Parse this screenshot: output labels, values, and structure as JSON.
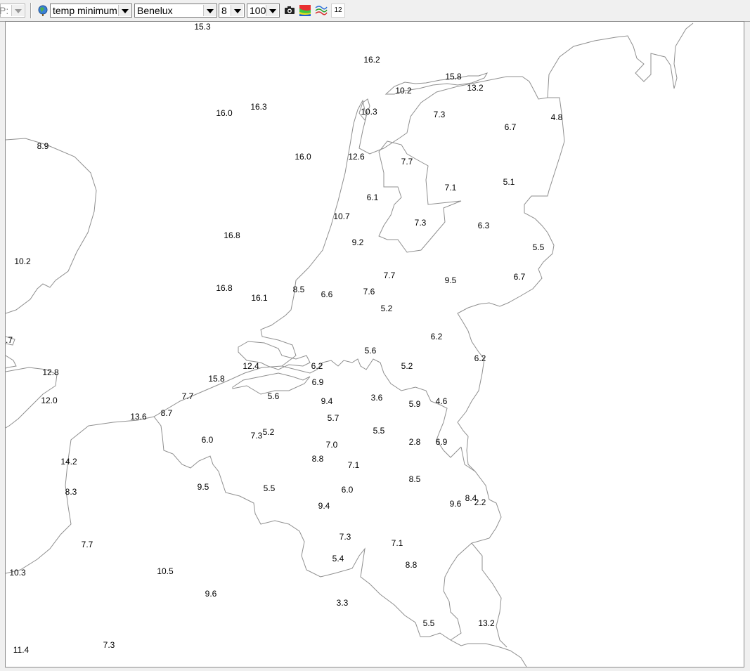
{
  "toolbar": {
    "partial_combo_text": "P:",
    "parameter_select": "temp minimum",
    "region_select": "Benelux",
    "level_select": "8",
    "zoom_select": "100",
    "badge": "12",
    "icons": [
      "globe-icon",
      "camera-icon",
      "color-map-icon",
      "streamlines-icon"
    ]
  },
  "map": {
    "region": "Benelux",
    "parameter": "temp minimum",
    "labels": [
      {
        "v": "15.3",
        "lon": 0,
        "lat": 0
      },
      {
        "v": "16.2"
      },
      {
        "v": "15.8"
      },
      {
        "v": "10.2"
      },
      {
        "v": "13.2"
      },
      {
        "v": "16.0"
      },
      {
        "v": "16.3"
      },
      {
        "v": "10.3"
      },
      {
        "v": "7.3"
      },
      {
        "v": "6.7"
      },
      {
        "v": "4.8"
      },
      {
        "v": "8.9"
      },
      {
        "v": "16.0"
      },
      {
        "v": "12.6"
      },
      {
        "v": "7.7"
      },
      {
        "v": "7.1"
      },
      {
        "v": "5.1"
      },
      {
        "v": "6.1"
      },
      {
        "v": "10.7"
      },
      {
        "v": "7.3"
      },
      {
        "v": "6.3"
      },
      {
        "v": "16.8"
      },
      {
        "v": "9.2"
      },
      {
        "v": "5.5"
      },
      {
        "v": "10.2"
      },
      {
        "v": "7.7"
      },
      {
        "v": "9.5"
      },
      {
        "v": "6.7"
      },
      {
        "v": "16.8"
      },
      {
        "v": "8.5"
      },
      {
        "v": "6.6"
      },
      {
        "v": "7.6"
      },
      {
        "v": "16.1"
      },
      {
        "v": "5.2"
      },
      {
        "v": ".7"
      },
      {
        "v": "6.2"
      },
      {
        "v": "5.6"
      },
      {
        "v": "6.2"
      },
      {
        "v": "12.4"
      },
      {
        "v": "6.2"
      },
      {
        "v": "5.2"
      },
      {
        "v": "12.8"
      },
      {
        "v": "15.8"
      },
      {
        "v": "6.9"
      },
      {
        "v": "7.7"
      },
      {
        "v": "5.6"
      },
      {
        "v": "9.4"
      },
      {
        "v": "3.6"
      },
      {
        "v": "5.9"
      },
      {
        "v": "4.6"
      },
      {
        "v": "12.0"
      },
      {
        "v": "13.6"
      },
      {
        "v": "8.7"
      },
      {
        "v": "5.7"
      },
      {
        "v": "5.5"
      },
      {
        "v": "6.0"
      },
      {
        "v": "7.3"
      },
      {
        "v": "5.2"
      },
      {
        "v": "7.0"
      },
      {
        "v": "2.8"
      },
      {
        "v": "6.9"
      },
      {
        "v": "14.2"
      },
      {
        "v": "8.8"
      },
      {
        "v": "7.1"
      },
      {
        "v": "8.5"
      },
      {
        "v": "9.5"
      },
      {
        "v": "5.5"
      },
      {
        "v": "6.0"
      },
      {
        "v": "8.3"
      },
      {
        "v": "8.4"
      },
      {
        "v": "9.6"
      },
      {
        "v": "2.2"
      },
      {
        "v": "9.4"
      },
      {
        "v": "7.3"
      },
      {
        "v": "7.7"
      },
      {
        "v": "7.1"
      },
      {
        "v": "5.4"
      },
      {
        "v": "8.8"
      },
      {
        "v": "10.3"
      },
      {
        "v": "10.5"
      },
      {
        "v": "9.6"
      },
      {
        "v": "3.3"
      },
      {
        "v": "5.5"
      },
      {
        "v": "13.2"
      },
      {
        "v": "11.4"
      },
      {
        "v": "7.3"
      }
    ]
  }
}
